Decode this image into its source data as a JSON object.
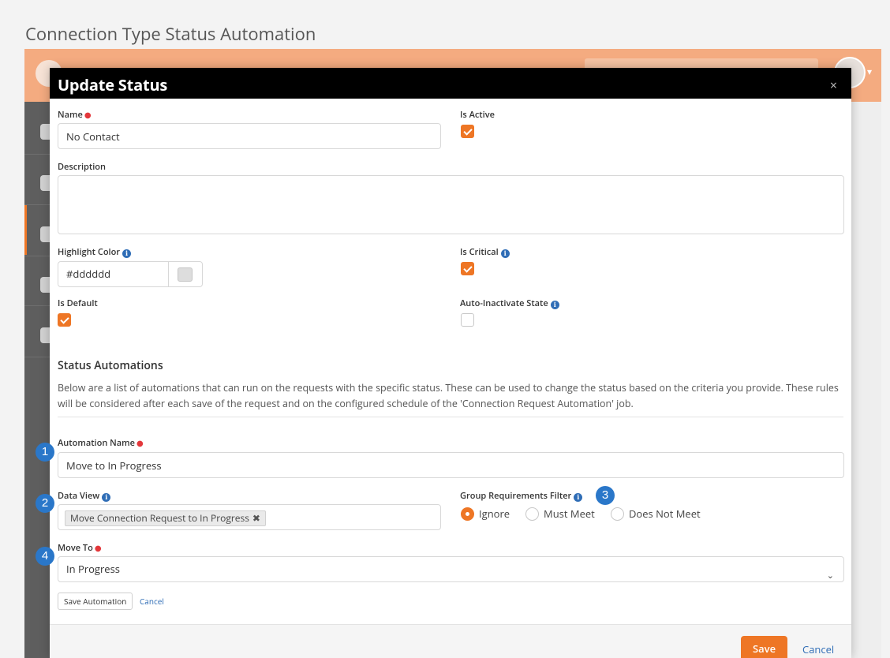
{
  "caption": "Connection Type Status Automation",
  "modal": {
    "title": "Update Status",
    "close_glyph": "×"
  },
  "fields": {
    "name_label": "Name",
    "name_value": "No Contact",
    "is_active_label": "Is Active",
    "is_active_checked": true,
    "description_label": "Description",
    "description_value": "",
    "highlight_color_label": "Highlight Color",
    "highlight_color_value": "#dddddd",
    "is_critical_label": "Is Critical",
    "is_critical_checked": true,
    "is_default_label": "Is Default",
    "is_default_checked": true,
    "auto_inactivate_label": "Auto-Inactivate State",
    "auto_inactivate_checked": false
  },
  "automations": {
    "title": "Status Automations",
    "description": "Below are a list of automations that can run on the requests with the specific status. These can be used to change the status based on the criteria you provide. These rules will be considered after each save of the request and on the configured schedule of the 'Connection Request Automation' job.",
    "automation_name_label": "Automation Name",
    "automation_name_value": "Move to In Progress",
    "data_view_label": "Data View",
    "data_view_tag": "Move Connection Request to In Progress",
    "tag_remove_glyph": "✖",
    "group_req_label": "Group Requirements Filter",
    "group_req_options": [
      "Ignore",
      "Must Meet",
      "Does Not Meet"
    ],
    "group_req_selected": "Ignore",
    "move_to_label": "Move To",
    "move_to_value": "In Progress",
    "save_automation_label": "Save Automation",
    "cancel_label": "Cancel"
  },
  "footer": {
    "save_label": "Save",
    "cancel_label": "Cancel"
  },
  "callouts": [
    "1",
    "2",
    "3",
    "4"
  ],
  "colors": {
    "accent": "#ee7625",
    "link": "#2f6db6",
    "header_bar": "#000000",
    "app_header": "#f4ab80",
    "callout": "#2a77c9"
  }
}
